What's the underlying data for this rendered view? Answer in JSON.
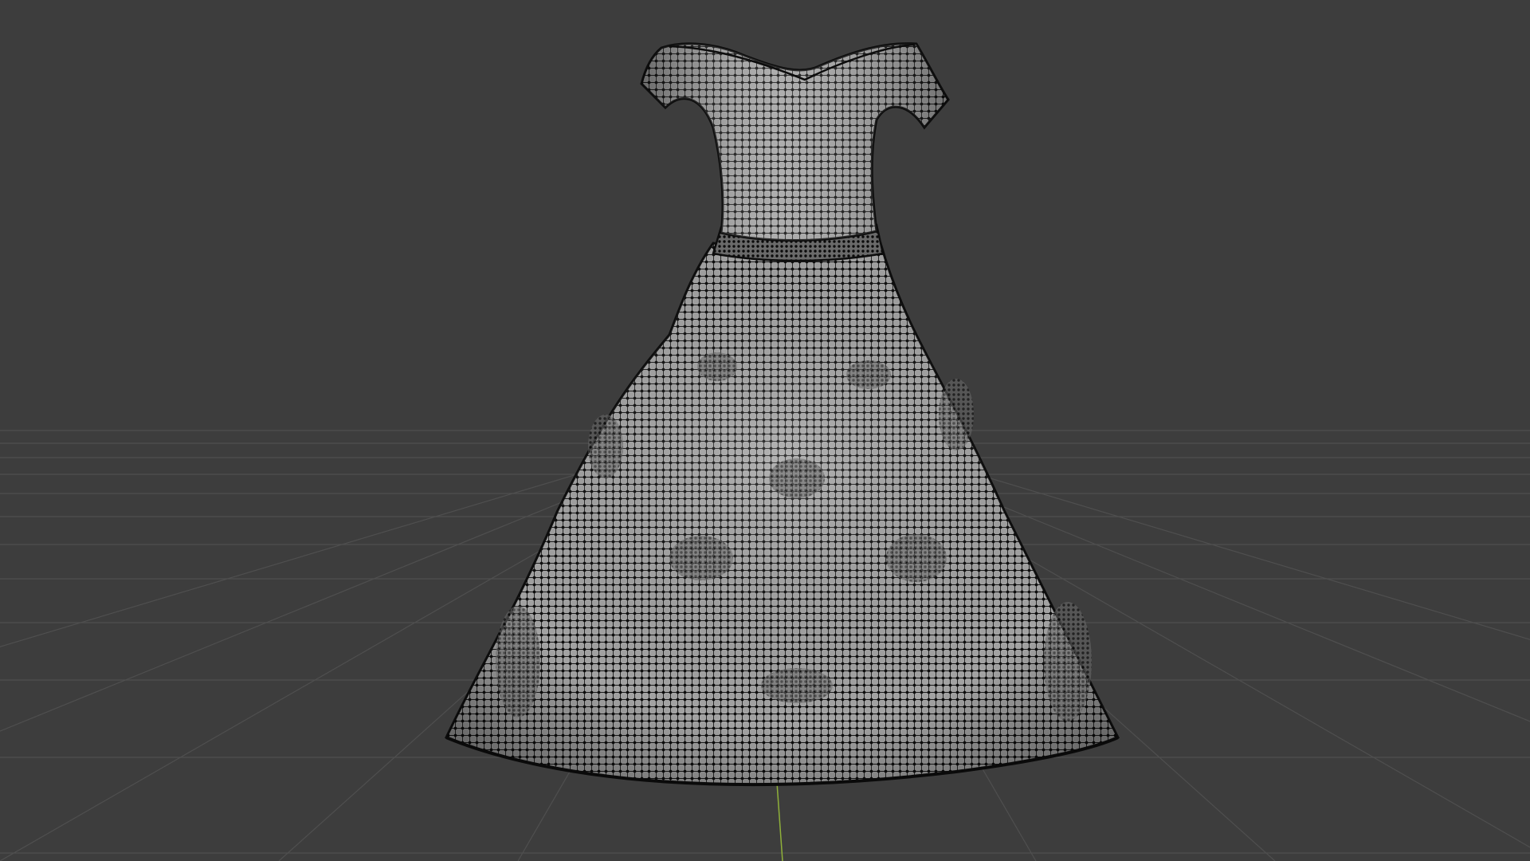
{
  "viewport": {
    "background": "#3d3d3d",
    "grid_color": "#505050",
    "y_axis_color": "#8fb03a"
  },
  "object": {
    "name": "Dress",
    "shading": "wireframe-over-solid",
    "surface_color": "#9c9c9c",
    "wire_color": "#111111"
  }
}
